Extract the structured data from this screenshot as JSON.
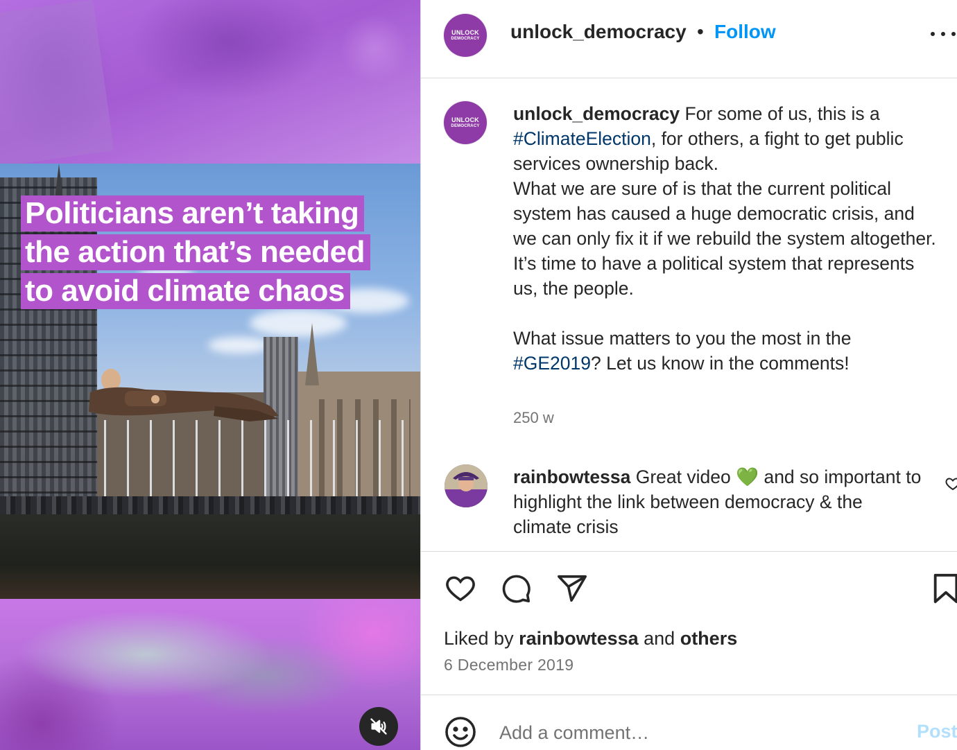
{
  "media": {
    "overlay_lines": [
      "Politicians aren’t taking",
      "the action that’s needed",
      "to avoid climate chaos"
    ],
    "mute_icon": "speaker-muted-icon"
  },
  "header": {
    "avatar_text_line1": "UNLOCK",
    "avatar_text_line2": "DEMOCRACY",
    "username": "unlock_democracy",
    "separator": "•",
    "follow_label": "Follow",
    "more_icon": "more-horizontal-icon"
  },
  "caption": {
    "username": "unlock_democracy",
    "text_1": " For some of us, this is a ",
    "hashtag_1": "#ClimateElection",
    "text_2": ", for others, a fight to get public services ownership back.",
    "text_3": "What we are sure of is that the current political system has caused a huge democratic crisis, and we can only fix it if we rebuild the system altogether.",
    "text_4": "It’s time to have a political system that represents us, the people.",
    "text_5": "What issue matters to you the most in the ",
    "hashtag_2": "#GE2019",
    "text_6": "? Let us know in the comments!",
    "time": "250 w"
  },
  "comment": {
    "username": "rainbowtessa",
    "text_1": " Great video ",
    "emoji": "💚",
    "text_2": " and so important to highlight the link between democracy & the climate crisis"
  },
  "actions": {
    "like_icon": "heart-icon",
    "comment_icon": "comment-bubble-icon",
    "share_icon": "paper-plane-icon",
    "save_icon": "bookmark-icon"
  },
  "likes": {
    "prefix": "Liked by ",
    "user": "rainbowtessa",
    "middle": " and ",
    "others": "others"
  },
  "date": "6 December 2019",
  "add_comment": {
    "placeholder": "Add a comment…",
    "post_label": "Post",
    "emoji_icon": "smiley-icon"
  },
  "colors": {
    "accent": "#0095f6",
    "hashtag": "#00376b",
    "brand_purple": "#8e3aa7",
    "overlay_purple": "#b254cc",
    "post_disabled": "#b2dffc"
  }
}
